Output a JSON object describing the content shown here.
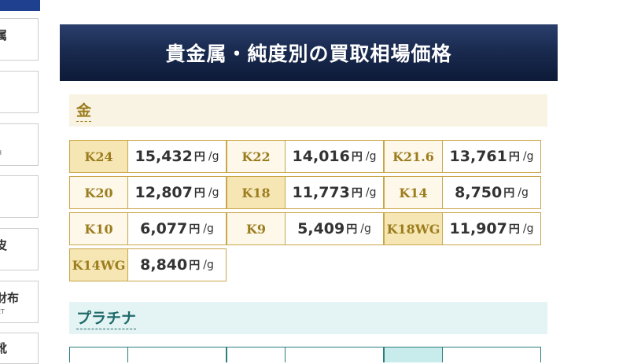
{
  "sidebar": {
    "items": [
      {
        "label": "属",
        "sub": ""
      },
      {
        "label": "",
        "sub": ""
      },
      {
        "label": "",
        "sub": "H"
      },
      {
        "label": "",
        "sub": ""
      },
      {
        "label": "皮",
        "sub": ""
      },
      {
        "label": "財布",
        "sub": "ET"
      },
      {
        "label": "靴",
        "sub": ""
      }
    ]
  },
  "page": {
    "title": "貴金属・純度別の買取相場価格"
  },
  "gold": {
    "heading": "金",
    "unit": "円",
    "per": "/g",
    "rows": [
      [
        {
          "grade": "K24",
          "price": "15,432",
          "highlight": true
        },
        {
          "grade": "K22",
          "price": "14,016",
          "highlight": false
        },
        {
          "grade": "K21.6",
          "price": "13,761",
          "highlight": false
        }
      ],
      [
        {
          "grade": "K20",
          "price": "12,807",
          "highlight": false
        },
        {
          "grade": "K18",
          "price": "11,773",
          "highlight": true
        },
        {
          "grade": "K14",
          "price": "8,750",
          "highlight": false
        }
      ],
      [
        {
          "grade": "K10",
          "price": "6,077",
          "highlight": false
        },
        {
          "grade": "K9",
          "price": "5,409",
          "highlight": false
        },
        {
          "grade": "K18WG",
          "price": "11,907",
          "highlight": true
        }
      ],
      [
        {
          "grade": "K14WG",
          "price": "8,840",
          "highlight": true
        }
      ]
    ]
  },
  "platinum": {
    "heading": "プラチナ"
  }
}
